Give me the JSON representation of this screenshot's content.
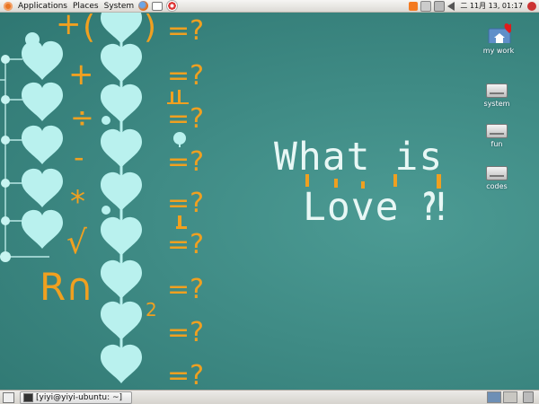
{
  "top_panel": {
    "menus": [
      "Applications",
      "Places",
      "System"
    ],
    "clock": "二 11月 13, 01:17"
  },
  "wallpaper": {
    "title_line1": "What is",
    "title_line2": "Love ⁈",
    "symbols": [
      "+",
      "(",
      ")",
      "+",
      "÷",
      "-",
      "*",
      "√",
      "R∩",
      "2"
    ],
    "equals_question": "=?",
    "colors": {
      "teal_bg": "#3f8b85",
      "heart": "#b9f1ee",
      "orange": "#f0a020",
      "title": "#e8f7f5"
    }
  },
  "desktop_icons": [
    {
      "label": "my work",
      "icon": "home-folder-icon"
    },
    {
      "label": "system",
      "icon": "drive-icon"
    },
    {
      "label": "fun",
      "icon": "drive-icon"
    },
    {
      "label": "codes",
      "icon": "drive-icon"
    }
  ],
  "bottom_panel": {
    "task": "[yiyi@yiyi-ubuntu: ~]"
  }
}
